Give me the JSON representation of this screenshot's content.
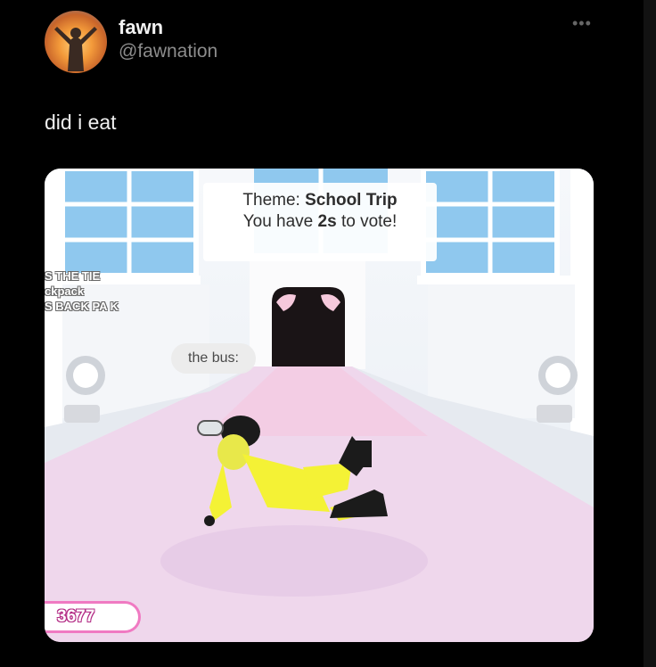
{
  "post": {
    "author_name": "fawn",
    "author_handle": "@fawnation",
    "more_icon": "ellipsis-icon",
    "text": "did i eat"
  },
  "game": {
    "theme_prefix": "Theme: ",
    "theme_name": "School Trip",
    "vote_prefix": "You have ",
    "vote_time": "2s",
    "vote_suffix": " to vote!",
    "side_lines": [
      "S THE TIE",
      "ckpack",
      "S BACK PA K"
    ],
    "chat_bubble": "the bus:",
    "counter": "3677"
  },
  "colors": {
    "background": "#000000",
    "counter_accent": "#f07ac2",
    "outfit": "#f4f235",
    "floor": "#efd4ea"
  }
}
